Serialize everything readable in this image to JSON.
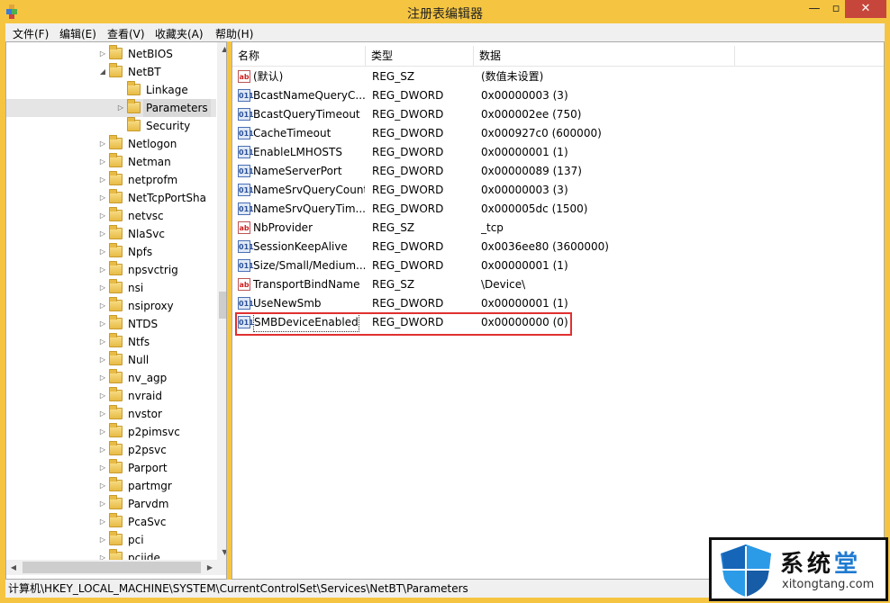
{
  "window": {
    "title": "注册表编辑器",
    "minimize": "—",
    "maximize": "▫",
    "close": "✕"
  },
  "menu": [
    "文件(F)",
    "编辑(E)",
    "查看(V)",
    "收藏夹(A)",
    "帮助(H)"
  ],
  "tree": [
    {
      "label": "NetBIOS",
      "depth": 0,
      "expander": "▷"
    },
    {
      "label": "NetBT",
      "depth": 0,
      "expander": "◢"
    },
    {
      "label": "Linkage",
      "depth": 1,
      "expander": ""
    },
    {
      "label": "Parameters",
      "depth": 1,
      "expander": "▷",
      "selected": true
    },
    {
      "label": "Security",
      "depth": 1,
      "expander": ""
    },
    {
      "label": "Netlogon",
      "depth": 0,
      "expander": "▷"
    },
    {
      "label": "Netman",
      "depth": 0,
      "expander": "▷"
    },
    {
      "label": "netprofm",
      "depth": 0,
      "expander": "▷"
    },
    {
      "label": "NetTcpPortSha",
      "depth": 0,
      "expander": "▷"
    },
    {
      "label": "netvsc",
      "depth": 0,
      "expander": "▷"
    },
    {
      "label": "NlaSvc",
      "depth": 0,
      "expander": "▷"
    },
    {
      "label": "Npfs",
      "depth": 0,
      "expander": "▷"
    },
    {
      "label": "npsvctrig",
      "depth": 0,
      "expander": "▷"
    },
    {
      "label": "nsi",
      "depth": 0,
      "expander": "▷"
    },
    {
      "label": "nsiproxy",
      "depth": 0,
      "expander": "▷"
    },
    {
      "label": "NTDS",
      "depth": 0,
      "expander": "▷"
    },
    {
      "label": "Ntfs",
      "depth": 0,
      "expander": "▷"
    },
    {
      "label": "Null",
      "depth": 0,
      "expander": "▷"
    },
    {
      "label": "nv_agp",
      "depth": 0,
      "expander": "▷"
    },
    {
      "label": "nvraid",
      "depth": 0,
      "expander": "▷"
    },
    {
      "label": "nvstor",
      "depth": 0,
      "expander": "▷"
    },
    {
      "label": "p2pimsvc",
      "depth": 0,
      "expander": "▷"
    },
    {
      "label": "p2psvc",
      "depth": 0,
      "expander": "▷"
    },
    {
      "label": "Parport",
      "depth": 0,
      "expander": "▷"
    },
    {
      "label": "partmgr",
      "depth": 0,
      "expander": "▷"
    },
    {
      "label": "Parvdm",
      "depth": 0,
      "expander": "▷"
    },
    {
      "label": "PcaSvc",
      "depth": 0,
      "expander": "▷"
    },
    {
      "label": "pci",
      "depth": 0,
      "expander": "▷"
    },
    {
      "label": "pciide",
      "depth": 0,
      "expander": "▷"
    }
  ],
  "columns": {
    "name": "名称",
    "type": "类型",
    "data": "数据"
  },
  "values": [
    {
      "name": "(默认)",
      "type": "REG_SZ",
      "data": "(数值未设置)",
      "icon": "sz"
    },
    {
      "name": "BcastNameQueryC...",
      "type": "REG_DWORD",
      "data": "0x00000003 (3)",
      "icon": "dw"
    },
    {
      "name": "BcastQueryTimeout",
      "type": "REG_DWORD",
      "data": "0x000002ee (750)",
      "icon": "dw"
    },
    {
      "name": "CacheTimeout",
      "type": "REG_DWORD",
      "data": "0x000927c0 (600000)",
      "icon": "dw"
    },
    {
      "name": "EnableLMHOSTS",
      "type": "REG_DWORD",
      "data": "0x00000001 (1)",
      "icon": "dw"
    },
    {
      "name": "NameServerPort",
      "type": "REG_DWORD",
      "data": "0x00000089 (137)",
      "icon": "dw"
    },
    {
      "name": "NameSrvQueryCount",
      "type": "REG_DWORD",
      "data": "0x00000003 (3)",
      "icon": "dw"
    },
    {
      "name": "NameSrvQueryTim...",
      "type": "REG_DWORD",
      "data": "0x000005dc (1500)",
      "icon": "dw"
    },
    {
      "name": "NbProvider",
      "type": "REG_SZ",
      "data": "_tcp",
      "icon": "sz"
    },
    {
      "name": "SessionKeepAlive",
      "type": "REG_DWORD",
      "data": "0x0036ee80 (3600000)",
      "icon": "dw"
    },
    {
      "name": "Size/Small/Medium...",
      "type": "REG_DWORD",
      "data": "0x00000001 (1)",
      "icon": "dw"
    },
    {
      "name": "TransportBindName",
      "type": "REG_SZ",
      "data": "\\Device\\",
      "icon": "sz"
    },
    {
      "name": "UseNewSmb",
      "type": "REG_DWORD",
      "data": "0x00000001 (1)",
      "icon": "dw"
    },
    {
      "name": "SMBDeviceEnabled",
      "type": "REG_DWORD",
      "data": "0x00000000 (0)",
      "icon": "dw",
      "focused": true
    }
  ],
  "icon_text": {
    "sz": "ab",
    "dw": "011"
  },
  "status": {
    "path": "计算机\\HKEY_LOCAL_MACHINE\\SYSTEM\\CurrentControlSet\\Services\\NetBT\\Parameters"
  },
  "watermark": {
    "title_a": "系统",
    "title_b": "堂",
    "url": "xitongtang.com"
  },
  "colors": {
    "title_bar": "#f5c542",
    "close_button": "#c7463b",
    "highlight_box": "#e03030",
    "selection": "#cce8ff"
  }
}
